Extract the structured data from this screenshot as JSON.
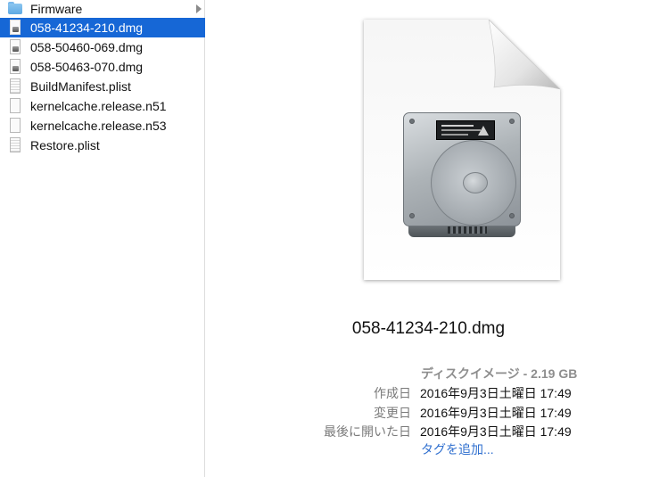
{
  "file_list": {
    "items": [
      {
        "name": "Firmware",
        "icon": "folder-icon",
        "selected": false,
        "has_children": true
      },
      {
        "name": "058-41234-210.dmg",
        "icon": "dmg-file-icon",
        "selected": true,
        "has_children": false
      },
      {
        "name": "058-50460-069.dmg",
        "icon": "dmg-file-icon",
        "selected": false,
        "has_children": false
      },
      {
        "name": "058-50463-070.dmg",
        "icon": "dmg-file-icon",
        "selected": false,
        "has_children": false
      },
      {
        "name": "BuildManifest.plist",
        "icon": "plist-file-icon",
        "selected": false,
        "has_children": false
      },
      {
        "name": "kernelcache.release.n51",
        "icon": "document-icon",
        "selected": false,
        "has_children": false
      },
      {
        "name": "kernelcache.release.n53",
        "icon": "document-icon",
        "selected": false,
        "has_children": false
      },
      {
        "name": "Restore.plist",
        "icon": "plist-file-icon",
        "selected": false,
        "has_children": false
      }
    ]
  },
  "preview": {
    "icon": "hard-disk-image-icon",
    "filename": "058-41234-210.dmg",
    "kind_size": "ディスクイメージ - 2.19 GB",
    "metadata": [
      {
        "label": "作成日",
        "value": "2016年9月3日土曜日 17:49"
      },
      {
        "label": "変更日",
        "value": "2016年9月3日土曜日 17:49"
      },
      {
        "label": "最後に開いた日",
        "value": "2016年9月3日土曜日 17:49"
      }
    ],
    "add_tags": "タグを追加..."
  },
  "colors": {
    "selection": "#1667d6",
    "link": "#2f6fcf",
    "label_gray": "#7a7a7a"
  }
}
